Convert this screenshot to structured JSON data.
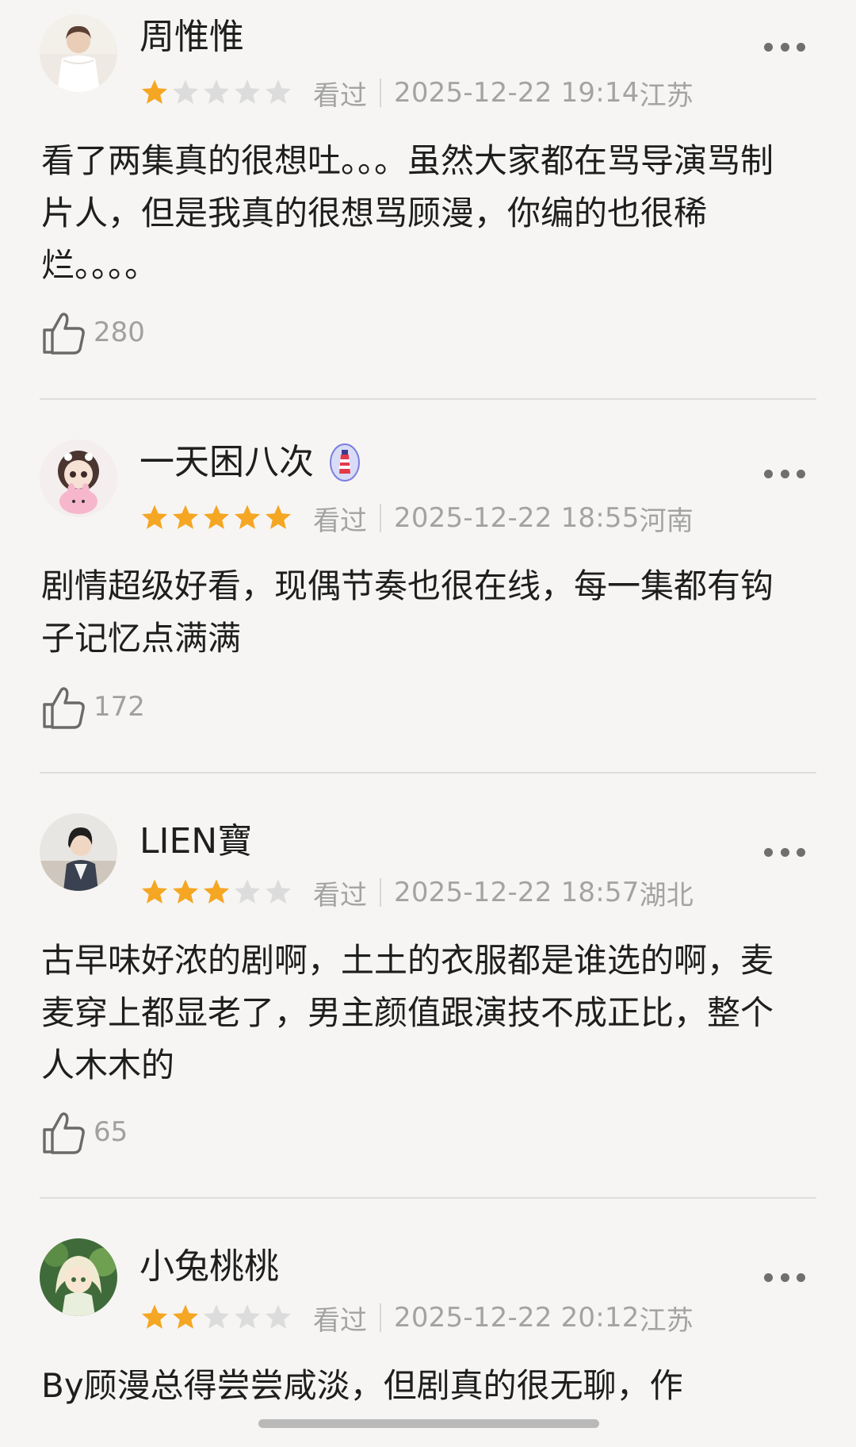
{
  "reviews": [
    {
      "username": "周惟惟",
      "rating": 1,
      "max_rating": 5,
      "status": "看过",
      "datetime": "2025-12-22 19:14",
      "location": "江苏",
      "content": "看了两集真的很想吐。。。虽然大家都在骂导演骂制片人，但是我真的很想骂顾漫，你编的也很稀烂。。。。",
      "likes": "280",
      "avatar": "avatar-white-dress"
    },
    {
      "username": "一天困八次",
      "badge": "lighthouse-badge-icon",
      "rating": 5,
      "max_rating": 5,
      "status": "看过",
      "datetime": "2025-12-22 18:55",
      "location": "河南",
      "content": "剧情超级好看，现偶节奏也很在线，每一集都有钩子记忆点满满",
      "likes": "172",
      "avatar": "avatar-doll-bunny"
    },
    {
      "username": "LIEN寶",
      "rating": 3,
      "max_rating": 5,
      "status": "看过",
      "datetime": "2025-12-22 18:57",
      "location": "湖北",
      "content": "古早味好浓的剧啊，土土的衣服都是谁选的啊，麦麦穿上都显老了，男主颜值跟演技不成正比，整个人木木的",
      "likes": "65",
      "avatar": "avatar-photo-person"
    },
    {
      "username": "小兔桃桃",
      "rating": 2,
      "max_rating": 5,
      "status": "看过",
      "datetime": "2025-12-22 20:12",
      "location": "江苏",
      "content": "By顾漫总得尝尝咸淡，但剧真的很无聊，作",
      "likes": "",
      "avatar": "avatar-anime-girl"
    }
  ],
  "colors": {
    "star_filled": "#f5a623",
    "star_empty": "#dcdcdc",
    "meta_text": "#a3a3a3",
    "background": "#f6f5f3"
  },
  "icons": {
    "like": "thumbs-up-icon",
    "more": "more-dots-icon"
  }
}
